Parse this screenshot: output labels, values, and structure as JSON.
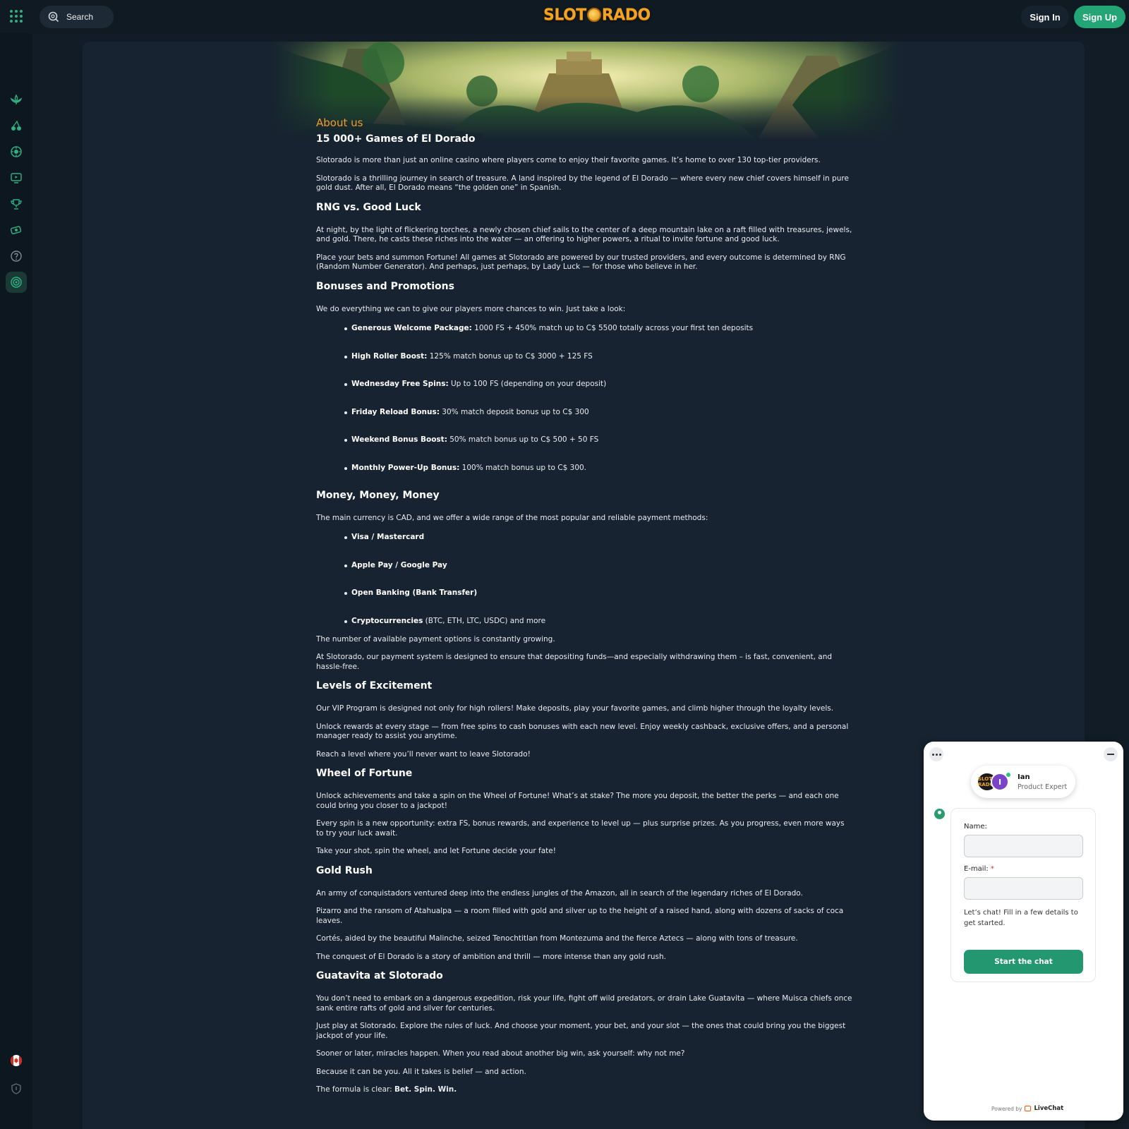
{
  "header": {
    "search_label": "Search",
    "logo_text": "SLOTORADO",
    "sign_in": "Sign In",
    "sign_up": "Sign Up"
  },
  "sidebar": {
    "items": [
      {
        "icon": "lotus-icon"
      },
      {
        "icon": "cherries-icon"
      },
      {
        "icon": "roulette-icon"
      },
      {
        "icon": "live-tv-icon"
      },
      {
        "icon": "trophy-icon"
      },
      {
        "icon": "money-icon"
      },
      {
        "icon": "help-icon"
      },
      {
        "icon": "bonus-wheel-icon"
      }
    ],
    "bottom": [
      {
        "icon": "canada-flag-icon"
      },
      {
        "icon": "shield-icon"
      }
    ]
  },
  "page": {
    "label": "About us",
    "title": "15 000+ Games of El Dorado",
    "intro": [
      "Slotorado is more than just an online casino where players come to enjoy their favorite games. It’s home to over 130 top-tier providers.",
      "Slotorado is a thrilling journey in search of treasure. A land inspired by the legend of El Dorado — where every new chief covers himself in pure gold dust. After all, El Dorado means “the golden one” in Spanish."
    ],
    "rng": {
      "heading": "RNG vs. Good Luck",
      "paragraphs": [
        "At night, by the light of flickering torches, a newly chosen chief sails to the center of a deep mountain lake on a raft filled with treasures, jewels, and gold. There, he casts these riches into the water — an offering to higher powers, a ritual to invite fortune and good luck.",
        "Place your bets and summon Fortune! All games at Slotorado are powered by our trusted providers, and every outcome is determined by RNG (Random Number Generator). And perhaps, just perhaps, by Lady Luck — for those who believe in her."
      ]
    },
    "bonuses": {
      "heading": "Bonuses and Promotions",
      "intro": "We do everything we can to give our players more chances to win. Just take a look:",
      "items": [
        {
          "name": "Generous Welcome Package:",
          "text": " 1000 FS + 450% match up to C$ 5500 totally across your first ten deposits"
        },
        {
          "name": "High Roller Boost:",
          "text": " 125% match bonus up to C$ 3000 + 125 FS"
        },
        {
          "name": "Wednesday Free Spins:",
          "text": " Up to 100 FS (depending on your deposit)"
        },
        {
          "name": "Friday Reload Bonus:",
          "text": " 30% match deposit bonus up to C$ 300"
        },
        {
          "name": "Weekend Bonus Boost:",
          "text": " 50% match bonus up to C$ 500 + 50 FS"
        },
        {
          "name": "Monthly Power-Up Bonus:",
          "text": " 100% match bonus up to C$ 300."
        }
      ]
    },
    "money": {
      "heading": "Money, Money, Money",
      "intro": "The main currency is CAD, and we offer a wide range of the most popular and reliable payment methods:",
      "items": [
        {
          "name": "Visa / Mastercard",
          "text": ""
        },
        {
          "name": "Apple Pay / Google Pay",
          "text": ""
        },
        {
          "name": "Open Banking (Bank Transfer)",
          "text": ""
        },
        {
          "name": "Cryptocurrencies",
          "text": " (BTC, ETH, LTC, USDC) and more"
        }
      ],
      "outro": [
        "The number of available payment options is constantly growing.",
        "At Slotorado, our payment system is designed to ensure that depositing funds—and especially withdrawing them – is fast, convenient, and hassle-free."
      ]
    },
    "levels": {
      "heading": "Levels of Excitement",
      "paragraphs": [
        "Our VIP Program is designed not only for high rollers! Make deposits, play your favorite games, and climb higher through the loyalty levels.",
        "Unlock rewards at every stage — from free spins to cash bonuses with each new level. Enjoy weekly cashback, exclusive offers, and a personal manager ready to assist you anytime.",
        "Reach a level where you’ll never want to leave Slotorado!"
      ]
    },
    "wheel": {
      "heading": "Wheel of Fortune",
      "paragraphs": [
        "Unlock achievements and take a spin on the Wheel of Fortune! What’s at stake? The more you deposit, the better the perks — and each one could bring you closer to a jackpot!",
        "Every spin is a new opportunity: extra FS, bonus rewards, and experience to level up — plus surprise prizes. As you progress, even more ways to try your luck await.",
        "Take your shot, spin the wheel, and let Fortune decide your fate!"
      ]
    },
    "gold": {
      "heading": "Gold Rush",
      "paragraphs": [
        "An army of conquistadors ventured deep into the endless jungles of the Amazon, all in search of the legendary riches of El Dorado.",
        "Pizarro and the ransom of Atahualpa — a room filled with gold and silver up to the height of a raised hand, along with dozens of sacks of coca leaves.",
        "Cortés, aided by the beautiful Malinche, seized Tenochtitlan from Montezuma and the fierce Aztecs — along with tons of treasure.",
        "The conquest of El Dorado is a story of ambition and thrill — more intense than any gold rush."
      ]
    },
    "guatavita": {
      "heading": "Guatavita at Slotorado",
      "paragraphs": [
        "You don’t need to embark on a dangerous expedition, risk your life, fight off wild predators, or drain Lake Guatavita — where Muisca chiefs once sank entire rafts of gold and silver for centuries.",
        "Just play at Slotorado. Explore the rules of luck. And choose your moment, your bet, and your slot — the ones that could bring you the biggest jackpot of your life.",
        "Sooner or later, miracles happen. When you read about another big win, ask yourself: why not me?",
        "Because it can be you. All it takes is belief — and action."
      ],
      "formula_prefix": "The formula is clear: ",
      "formula_bold": "Bet. Spin. Win."
    }
  },
  "chat": {
    "agent_name": "Ian",
    "agent_role": "Product Expert",
    "agent_initial": "I",
    "brand_badge": "SLOTO RADO",
    "name_label": "Name:",
    "email_label": "E-mail:",
    "email_required": "*",
    "note": "Let’s chat! Fill in a few details to get started.",
    "start_button": "Start the chat",
    "powered_by": "Powered by",
    "powered_brand": "LiveChat"
  }
}
